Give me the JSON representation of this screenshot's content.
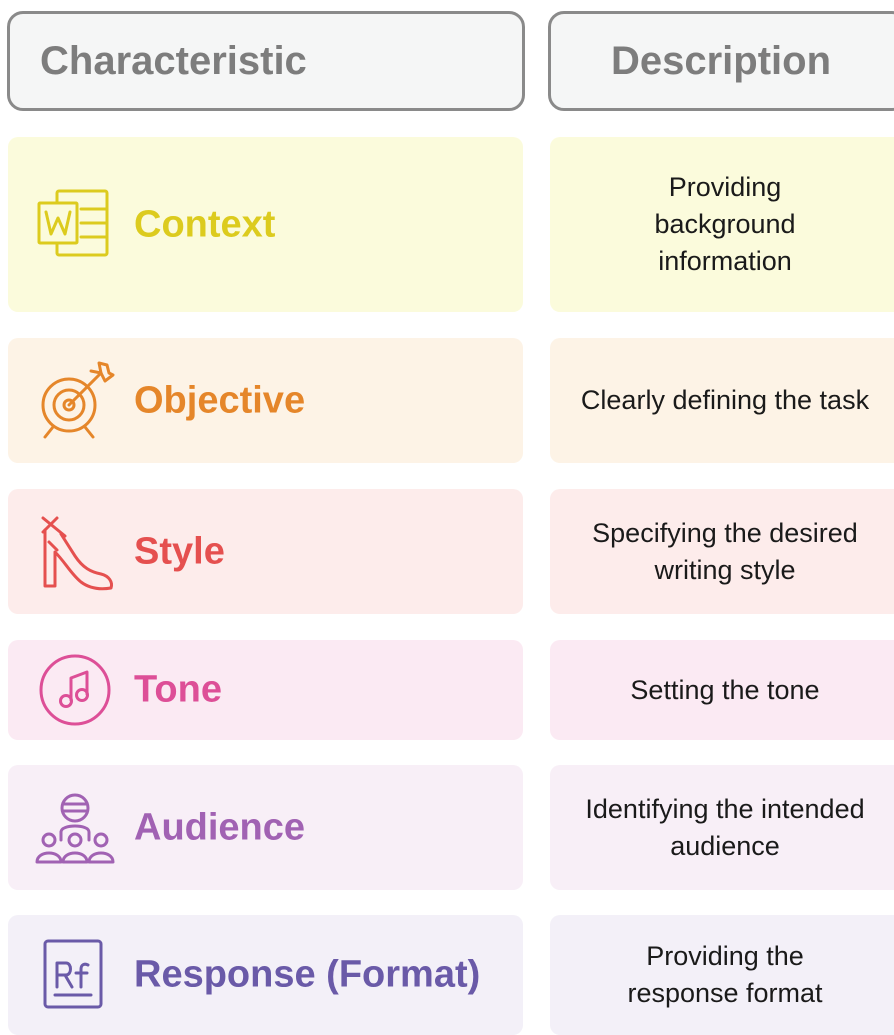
{
  "header": {
    "characteristic": "Characteristic",
    "description": "Description"
  },
  "rows": [
    {
      "label": "Context",
      "description": "Providing background information",
      "icon": "word-document-icon",
      "color": "#dccb1e",
      "background": "#fbfbdc"
    },
    {
      "label": "Objective",
      "description": "Clearly defining the task",
      "icon": "target-arrow-icon",
      "color": "#e5862a",
      "background": "#fdf3e6"
    },
    {
      "label": "Style",
      "description": "Specifying the desired writing style",
      "icon": "high-heel-shoe-icon",
      "color": "#e5504f",
      "background": "#fdeceb"
    },
    {
      "label": "Tone",
      "description": "Setting the tone",
      "icon": "music-note-circle-icon",
      "color": "#dd4f97",
      "background": "#fbeaf3"
    },
    {
      "label": "Audience",
      "description": "Identifying the intended audience",
      "icon": "audience-group-icon",
      "color": "#a162b3",
      "background": "#f8eff7"
    },
    {
      "label": "Response (Format)",
      "description": "Providing the response format",
      "icon": "rf-format-icon",
      "color": "#6a5aa8",
      "background": "#f3f0f8"
    }
  ]
}
